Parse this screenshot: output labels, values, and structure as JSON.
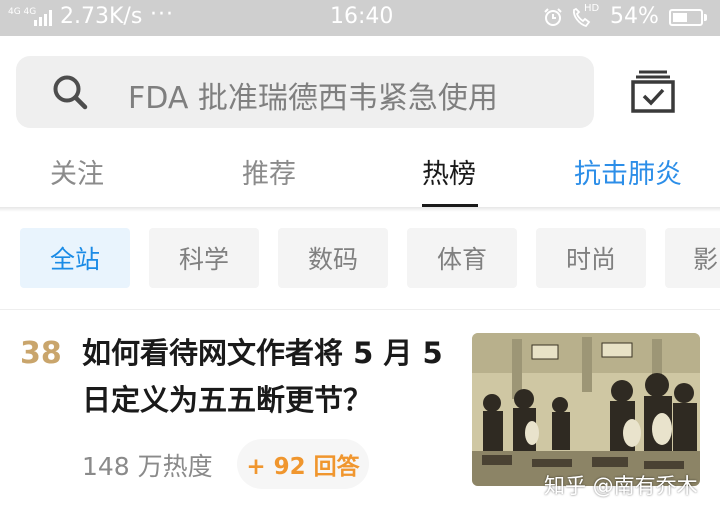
{
  "status_bar": {
    "network": "4G 4G",
    "speed": "2.73K/s",
    "more": "···",
    "time": "16:40",
    "hd": "HD",
    "battery_text": "54%",
    "battery_level": 0.54
  },
  "search": {
    "placeholder": "FDA 批准瑞德西韦紧急使用",
    "icon": "search-icon",
    "right_icon": "tasks-icon"
  },
  "tabs": [
    {
      "label": "关注"
    },
    {
      "label": "推荐"
    },
    {
      "label": "热榜",
      "active": true
    },
    {
      "label": "抗击肺炎",
      "color": "#2c8ee8"
    }
  ],
  "categories": [
    "全站",
    "科学",
    "数码",
    "体育",
    "时尚",
    "影"
  ],
  "active_category": "全站",
  "feed": [
    {
      "rank": "38",
      "title": "如何看待网文作者将 5 月 5 日定义为五五断更节？",
      "heat": "148 万热度",
      "answers": "+ 92 回答",
      "watermark": "知乎 @南有乔木"
    }
  ],
  "colors": {
    "accent": "#1a8be6",
    "rank": "#c9a56c",
    "answers": "#f0962e",
    "status_bar": "#cfcfcf"
  }
}
